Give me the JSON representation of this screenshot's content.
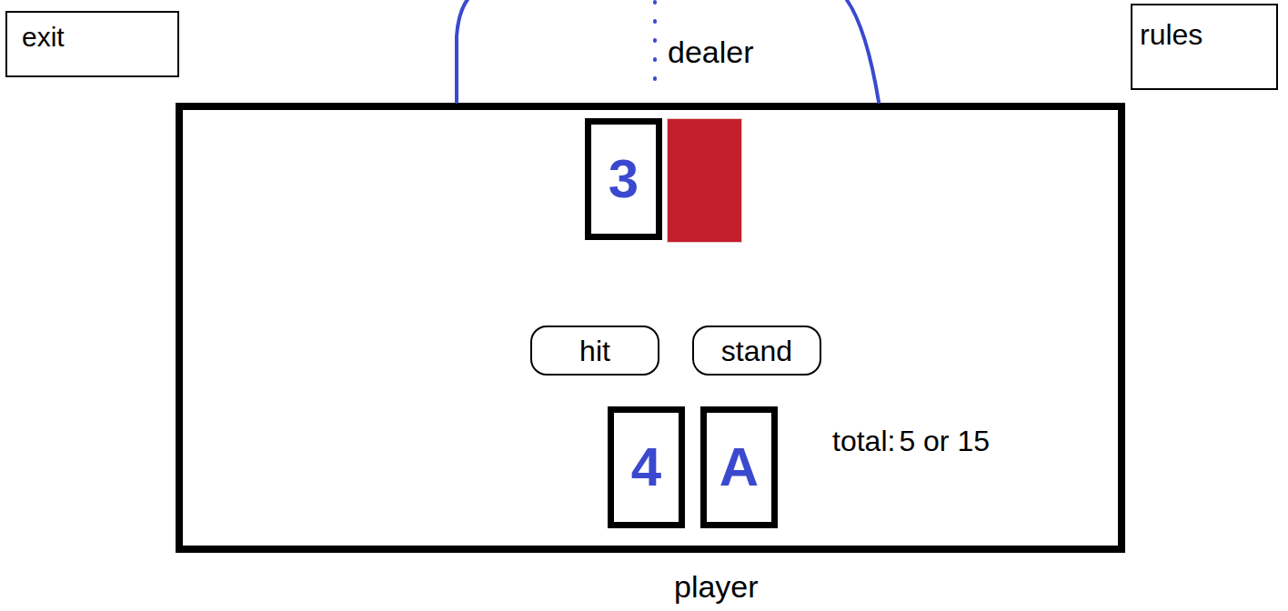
{
  "header": {
    "exit": "exit",
    "rules": "rules"
  },
  "dealer": {
    "label": "dealer",
    "cards": [
      {
        "rank": "3",
        "face_up": true
      },
      {
        "rank": "",
        "face_up": false
      }
    ]
  },
  "buttons": [
    "hit",
    "stand"
  ],
  "player": {
    "label": "player",
    "cards": [
      {
        "rank": "4",
        "face_up": true
      },
      {
        "rank": "A",
        "face_up": true
      }
    ],
    "total_label": "total:",
    "total": "5 or 15"
  }
}
